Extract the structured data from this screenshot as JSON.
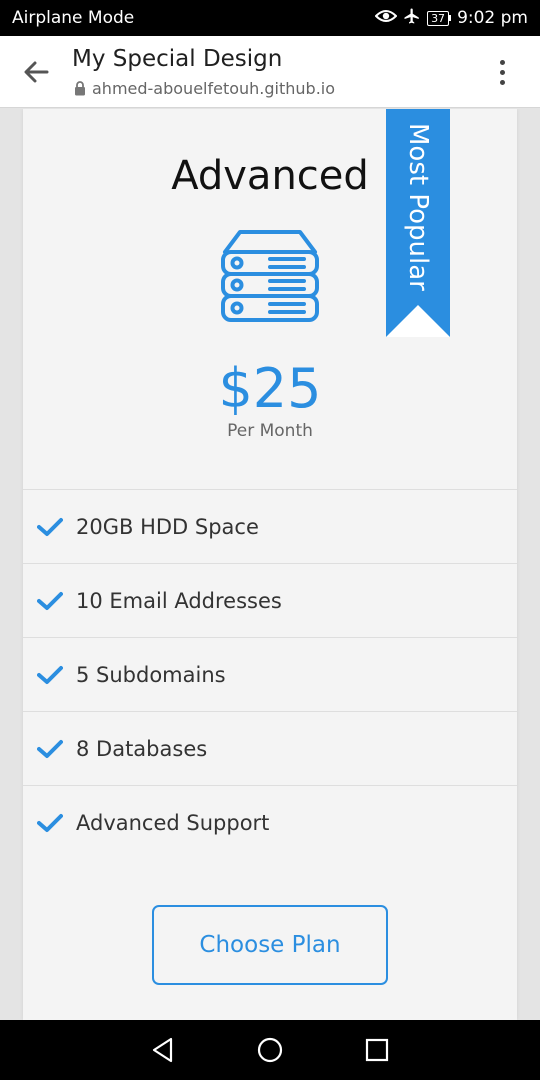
{
  "status_bar": {
    "left_text": "Airplane Mode",
    "battery": "37",
    "time": "9:02 pm",
    "icons": [
      "eye-icon",
      "airplane-icon",
      "battery-icon"
    ]
  },
  "browser": {
    "title": "My Special Design",
    "url": "ahmed-abouelfetouh.github.io",
    "icons": [
      "back-arrow-icon",
      "lock-icon",
      "more-vert-icon"
    ]
  },
  "plan": {
    "name": "Advanced",
    "ribbon": "Most Popular",
    "price": "$25",
    "period": "Per Month",
    "features": [
      "20GB HDD Space",
      "10 Email Addresses",
      "5 Subdomains",
      "8 Databases",
      "Advanced Support"
    ],
    "button_label": "Choose Plan",
    "icon": "server-icon"
  },
  "nav": {
    "icons": [
      "back-triangle-icon",
      "home-circle-icon",
      "recents-square-icon"
    ]
  },
  "colors": {
    "accent": "#2b8ee0",
    "card": "#f4f4f4",
    "page": "#e4e4e4"
  }
}
